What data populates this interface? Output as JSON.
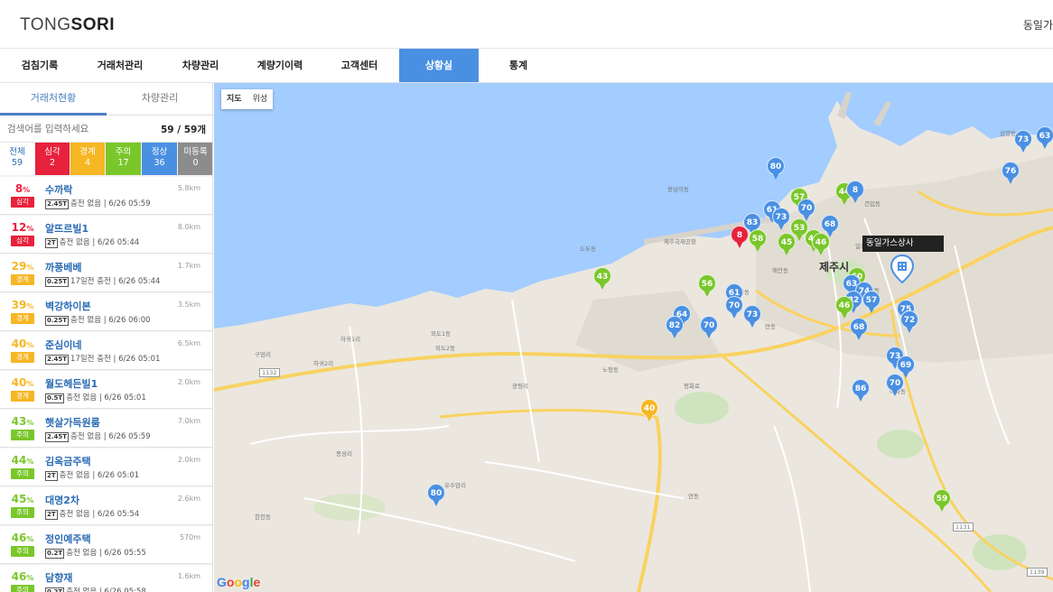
{
  "header": {
    "logo_light": "TONG",
    "logo_bold": "SORI",
    "user": "동일가"
  },
  "nav": [
    {
      "label": "검침기록",
      "active": false
    },
    {
      "label": "거래처관리",
      "active": false
    },
    {
      "label": "차량관리",
      "active": false
    },
    {
      "label": "계량기이력",
      "active": false
    },
    {
      "label": "고객센터",
      "active": false
    },
    {
      "label": "상황실",
      "active": true
    },
    {
      "label": "통계",
      "active": false
    }
  ],
  "sidebar": {
    "tabs": [
      {
        "label": "거래처현황",
        "active": true
      },
      {
        "label": "차량관리",
        "active": false
      }
    ],
    "search_placeholder": "검색어를 입력하세요",
    "count": "59 / 59개",
    "filters": [
      {
        "label": "전체",
        "value": "59",
        "color": "#ffffff",
        "text": "#2a6bb5"
      },
      {
        "label": "심각",
        "value": "2",
        "color": "#e8213c",
        "text": "#ffffff"
      },
      {
        "label": "경계",
        "value": "4",
        "color": "#f7b624",
        "text": "#ffffff"
      },
      {
        "label": "주의",
        "value": "17",
        "color": "#7ac72b",
        "text": "#ffffff"
      },
      {
        "label": "정상",
        "value": "36",
        "color": "#4a90e2",
        "text": "#ffffff"
      },
      {
        "label": "미등록",
        "value": "0",
        "color": "#8c8c8c",
        "text": "#ffffff"
      }
    ],
    "items": [
      {
        "pct": "8",
        "status": "심각",
        "color": "#e8213c",
        "name": "수까락",
        "tank": "2.45T",
        "charge": "충전 없음 | 6/26 05:59",
        "dist": "5.8km"
      },
      {
        "pct": "12",
        "status": "심각",
        "color": "#e8213c",
        "name": "알뜨르빌1",
        "tank": "2T",
        "charge": "충전 없음 | 6/26 05:44",
        "dist": "8.0km"
      },
      {
        "pct": "29",
        "status": "경계",
        "color": "#f7b624",
        "name": "까풍베베",
        "tank": "0.25T",
        "charge": "17일전 충전 | 6/26 05:44",
        "dist": "1.7km"
      },
      {
        "pct": "39",
        "status": "경계",
        "color": "#f7b624",
        "name": "벽강하이본",
        "tank": "0.25T",
        "charge": "충전 없음 | 6/26 06:00",
        "dist": "3.5km"
      },
      {
        "pct": "40",
        "status": "경계",
        "color": "#f7b624",
        "name": "준심이네",
        "tank": "2.45T",
        "charge": "17일전 충전 | 6/26 05:01",
        "dist": "6.5km"
      },
      {
        "pct": "40",
        "status": "경계",
        "color": "#f7b624",
        "name": "월도헤든빌1",
        "tank": "0.5T",
        "charge": "충전 없음 | 6/26 05:01",
        "dist": "2.0km"
      },
      {
        "pct": "43",
        "status": "주의",
        "color": "#7ac72b",
        "name": "햇살가득원룸",
        "tank": "2.45T",
        "charge": "충전 없음 | 6/26 05:59",
        "dist": "7.0km"
      },
      {
        "pct": "44",
        "status": "주의",
        "color": "#7ac72b",
        "name": "김옥금주택",
        "tank": "2T",
        "charge": "충전 없음 | 6/26 05:01",
        "dist": "2.0km"
      },
      {
        "pct": "45",
        "status": "주의",
        "color": "#7ac72b",
        "name": "대명2차",
        "tank": "2T",
        "charge": "충전 없음 | 6/26 05:54",
        "dist": "2.6km"
      },
      {
        "pct": "46",
        "status": "주의",
        "color": "#7ac72b",
        "name": "정인예주택",
        "tank": "0.2T",
        "charge": "충전 없음 | 6/26 05:55",
        "dist": "570m"
      },
      {
        "pct": "46",
        "status": "주의",
        "color": "#7ac72b",
        "name": "담향재",
        "tank": "0.2T",
        "charge": "충전 없음 | 6/26 05:58",
        "dist": "1.6km"
      }
    ]
  },
  "map": {
    "type_labels": [
      "지도",
      "위성"
    ],
    "tooltip": "동일가스상사",
    "city_label": "제주시",
    "google": [
      "G",
      "o",
      "o",
      "g",
      "l",
      "e"
    ],
    "place_labels": [
      "용담이동",
      "제주국제공항",
      "도두동",
      "연동",
      "노형동",
      "일도이동",
      "건입동",
      "이도2동",
      "아라동",
      "오라동",
      "외도1동",
      "외도2동",
      "하귀1리",
      "하귀2리",
      "삼양동",
      "한천동",
      "연동",
      "봉성리",
      "구엄리",
      "광령리",
      "유수암리",
      "평화로",
      "해안동",
      "1132",
      "1131",
      "1139"
    ],
    "markers": [
      {
        "v": "80",
        "c": "#4a90e2"
      },
      {
        "v": "73",
        "c": "#4a90e2"
      },
      {
        "v": "63",
        "c": "#4a90e2"
      },
      {
        "v": "76",
        "c": "#4a90e2"
      },
      {
        "v": "57",
        "c": "#7ac72b"
      },
      {
        "v": "44",
        "c": "#7ac72b"
      },
      {
        "v": "8",
        "c": "#4a90e2"
      },
      {
        "v": "61",
        "c": "#4a90e2"
      },
      {
        "v": "73",
        "c": "#4a90e2"
      },
      {
        "v": "70",
        "c": "#4a90e2"
      },
      {
        "v": "83",
        "c": "#4a90e2"
      },
      {
        "v": "53",
        "c": "#7ac72b"
      },
      {
        "v": "48",
        "c": "#7ac72b"
      },
      {
        "v": "68",
        "c": "#4a90e2"
      },
      {
        "v": "8",
        "c": "#e8213c"
      },
      {
        "v": "58",
        "c": "#7ac72b"
      },
      {
        "v": "45",
        "c": "#7ac72b"
      },
      {
        "v": "46",
        "c": "#7ac72b"
      },
      {
        "v": "60",
        "c": "#7ac72b"
      },
      {
        "v": "43",
        "c": "#7ac72b"
      },
      {
        "v": "56",
        "c": "#7ac72b"
      },
      {
        "v": "63",
        "c": "#4a90e2"
      },
      {
        "v": "74",
        "c": "#4a90e2"
      },
      {
        "v": "61",
        "c": "#4a90e2"
      },
      {
        "v": "82",
        "c": "#4a90e2"
      },
      {
        "v": "57",
        "c": "#4a90e2"
      },
      {
        "v": "70",
        "c": "#4a90e2"
      },
      {
        "v": "46",
        "c": "#7ac72b"
      },
      {
        "v": "75",
        "c": "#4a90e2"
      },
      {
        "v": "64",
        "c": "#4a90e2"
      },
      {
        "v": "73",
        "c": "#4a90e2"
      },
      {
        "v": "82",
        "c": "#4a90e2"
      },
      {
        "v": "70",
        "c": "#4a90e2"
      },
      {
        "v": "68",
        "c": "#4a90e2"
      },
      {
        "v": "72",
        "c": "#4a90e2"
      },
      {
        "v": "73",
        "c": "#4a90e2"
      },
      {
        "v": "69",
        "c": "#4a90e2"
      },
      {
        "v": "86",
        "c": "#4a90e2"
      },
      {
        "v": "70",
        "c": "#4a90e2"
      },
      {
        "v": "40",
        "c": "#f7b624"
      },
      {
        "v": "80",
        "c": "#4a90e2"
      },
      {
        "v": "59",
        "c": "#7ac72b"
      }
    ]
  }
}
